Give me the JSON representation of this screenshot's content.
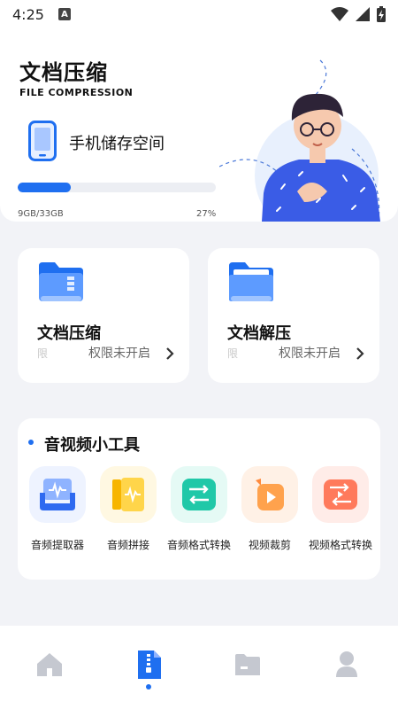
{
  "status": {
    "time": "4:25",
    "notification_badge": "A"
  },
  "header": {
    "title": "文档压缩",
    "subtitle": "FILE COMPRESSION",
    "storage_label": "手机储存空间",
    "storage_used": "9GB/33GB",
    "storage_percent": "27%",
    "storage_fraction": 0.27
  },
  "cards": [
    {
      "title": "文档压缩",
      "ghost": "限",
      "permission": "权限未开启",
      "icon": "folder-zip-icon"
    },
    {
      "title": "文档解压",
      "ghost": "限",
      "permission": "权限未开启",
      "icon": "folder-open-icon"
    }
  ],
  "tools": {
    "title": "音视频小工具",
    "items": [
      {
        "label": "音频提取器",
        "icon": "audio-extract-icon"
      },
      {
        "label": "音频拼接",
        "icon": "audio-merge-icon"
      },
      {
        "label": "音频格式转换",
        "icon": "audio-convert-icon"
      },
      {
        "label": "视频裁剪",
        "icon": "video-crop-icon"
      },
      {
        "label": "视频格式转换",
        "icon": "video-convert-icon"
      }
    ]
  },
  "tabbar": {
    "items": [
      "home-icon",
      "zip-file-icon",
      "folder-icon",
      "profile-icon"
    ],
    "active_index": 1
  },
  "colors": {
    "accent": "#1f6ff0",
    "page_bg": "#f2f3f7"
  }
}
